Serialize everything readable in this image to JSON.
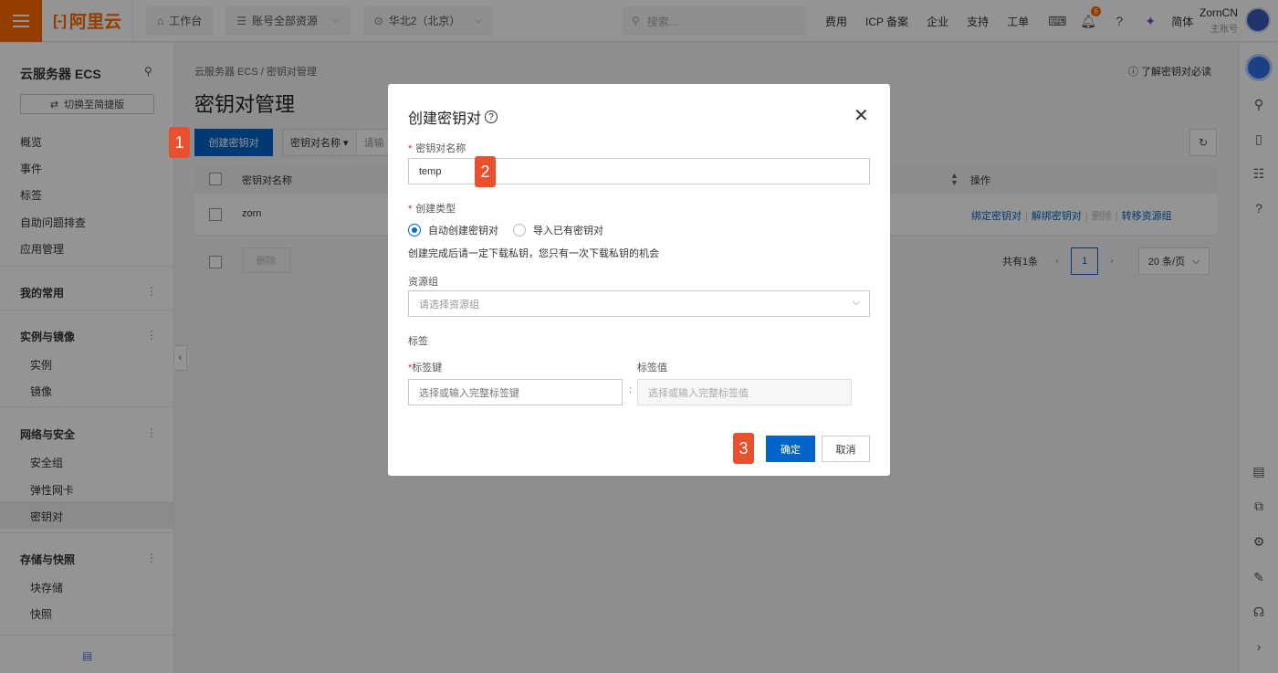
{
  "topbar": {
    "logo": "阿里云",
    "workbench": "工作台",
    "resources": "账号全部资源",
    "region": "华北2（北京）",
    "search_placeholder": "搜索...",
    "links": [
      "费用",
      "ICP 备案",
      "企业",
      "支持",
      "工单"
    ],
    "notification_count": "6",
    "language": "简体",
    "user_name": "ZornCN",
    "user_role": "主账号"
  },
  "sidebar": {
    "title": "云服务器 ECS",
    "switch_label": "切换至简捷版",
    "items": [
      "概览",
      "事件",
      "标签",
      "自助问题排查",
      "应用管理"
    ],
    "groups": [
      {
        "label": "我的常用",
        "items": []
      },
      {
        "label": "实例与镜像",
        "items": [
          "实例",
          "镜像"
        ]
      },
      {
        "label": "网络与安全",
        "items": [
          "安全组",
          "弹性网卡",
          "密钥对"
        ]
      },
      {
        "label": "存储与快照",
        "items": [
          "块存储",
          "快照"
        ]
      }
    ],
    "active_item": "密钥对"
  },
  "main": {
    "breadcrumb": [
      "云服务器 ECS",
      "密钥对管理"
    ],
    "guide_link": "了解密钥对必读",
    "page_title": "密钥对管理",
    "create_button": "创建密钥对",
    "filter_select": "密钥对名称",
    "filter_placeholder": "请输",
    "table": {
      "columns": [
        "密钥对名称",
        "操作"
      ],
      "rows": [
        {
          "name": "zorn",
          "ops": [
            "绑定密钥对",
            "解绑密钥对",
            "删除",
            "转移资源组"
          ]
        }
      ]
    },
    "delete_button": "删除",
    "pagination": {
      "total": "共有1条",
      "current_page": "1",
      "page_size": "20 条/页"
    }
  },
  "modal": {
    "title": "创建密钥对",
    "name_label": "密钥对名称",
    "name_value": "temp",
    "type_label": "创建类型",
    "type_options": [
      "自动创建密钥对",
      "导入已有密钥对"
    ],
    "type_selected": "自动创建密钥对",
    "tip": "创建完成后请一定下载私钥，您只有一次下载私钥的机会",
    "resource_group_label": "资源组",
    "resource_group_placeholder": "请选择资源组",
    "tags_label": "标签",
    "tag_key_label": "标签键",
    "tag_value_label": "标签值",
    "tag_key_placeholder": "选择或输入完整标签键",
    "tag_value_placeholder": "选择或输入完整标签值",
    "tag_separator": ":",
    "ok_button": "确定",
    "cancel_button": "取消"
  },
  "steps": [
    "1",
    "2",
    "3"
  ],
  "colors": {
    "brand": "#ff6a00",
    "primary": "#0064c8",
    "step_marker": "#e8502e"
  }
}
